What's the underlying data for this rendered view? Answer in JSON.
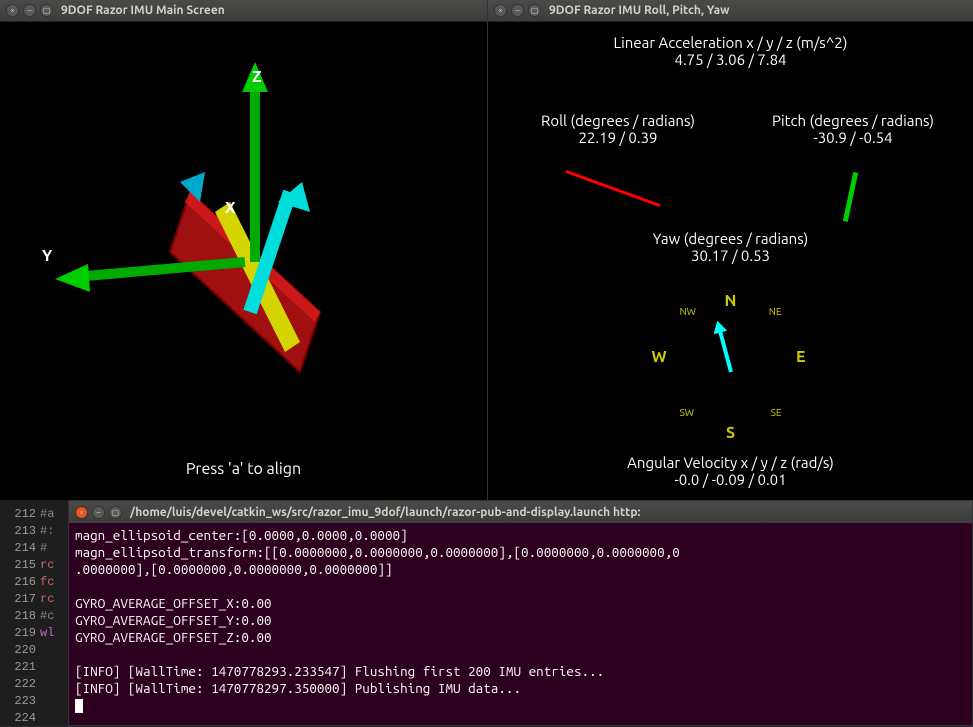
{
  "left_window": {
    "title": "9DOF Razor IMU Main Screen",
    "hint": "Press 'a' to align",
    "axes": {
      "x": "X",
      "y": "Y",
      "z": "Z"
    }
  },
  "right_window": {
    "title": "9DOF Razor IMU Roll, Pitch, Yaw",
    "linaccel": {
      "label": "Linear Acceleration x / y / z (m/s^2)",
      "value": "4.75 / 3.06 / 7.84"
    },
    "roll": {
      "label": "Roll (degrees / radians)",
      "value": "22.19 / 0.39"
    },
    "pitch": {
      "label": "Pitch (degrees / radians)",
      "value": "-30.9 / -0.54"
    },
    "yaw": {
      "label": "Yaw (degrees / radians)",
      "value": "30.17 / 0.53"
    },
    "angvel": {
      "label": "Angular Velocity x / y / z (rad/s)",
      "value": "-0.0 / -0.09 / 0.01"
    },
    "compass": {
      "n": "N",
      "s": "S",
      "e": "E",
      "w": "W",
      "ne": "NE",
      "nw": "NW",
      "se": "SE",
      "sw": "SW"
    }
  },
  "editor_gutter": [
    "212",
    "213",
    "214",
    "215",
    "216",
    "217",
    "218",
    "219",
    "220",
    "221",
    "222",
    "223",
    "224"
  ],
  "code_sliver": [
    "#a",
    "#:",
    "# ",
    "rc",
    "fc",
    " ",
    "rc",
    "#c",
    " ",
    "wl",
    " ",
    " ",
    " "
  ],
  "terminal": {
    "title": "/home/luis/devel/catkin_ws/src/razor_imu_9dof/launch/razor-pub-and-display.launch http:",
    "lines": [
      "magn_ellipsoid_center:[0.0000,0.0000,0.0000]",
      "magn_ellipsoid_transform:[[0.0000000,0.0000000,0.0000000],[0.0000000,0.0000000,0",
      ".0000000],[0.0000000,0.0000000,0.0000000]]",
      "",
      "GYRO_AVERAGE_OFFSET_X:0.00",
      "GYRO_AVERAGE_OFFSET_Y:0.00",
      "GYRO_AVERAGE_OFFSET_Z:0.00",
      "",
      "[INFO] [WallTime: 1470778293.233547] Flushing first 200 IMU entries...",
      "[INFO] [WallTime: 1470778297.350000] Publishing IMU data..."
    ]
  }
}
